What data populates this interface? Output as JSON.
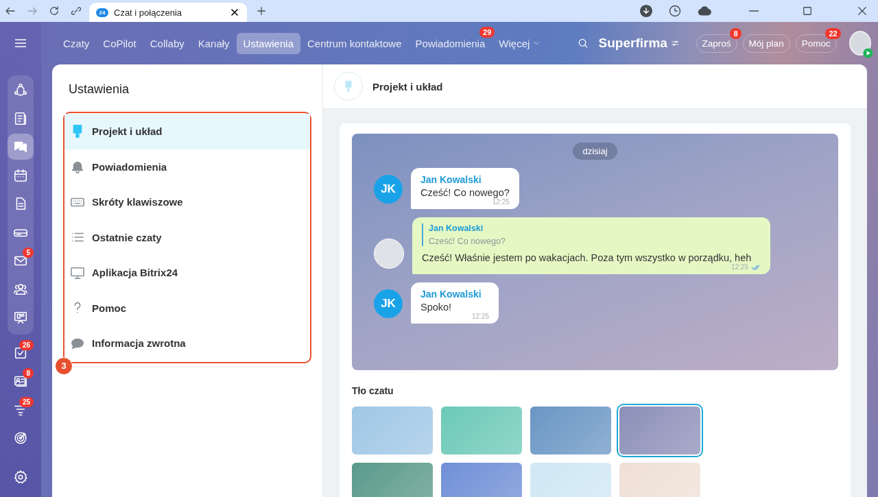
{
  "browser": {
    "tab_icon_text": "24",
    "tab_title": "Czat i połączenia"
  },
  "nav": {
    "tabs": [
      {
        "label": "Czaty",
        "selected": false
      },
      {
        "label": "CoPilot",
        "selected": false
      },
      {
        "label": "Collaby",
        "selected": false
      },
      {
        "label": "Kanały",
        "selected": false
      },
      {
        "label": "Ustawienia",
        "selected": true
      },
      {
        "label": "Centrum kontaktowe",
        "selected": false
      },
      {
        "label": "Powiadomienia",
        "selected": false,
        "badge": "29"
      },
      {
        "label": "Więcej",
        "selected": false
      }
    ],
    "company": "Superfirma",
    "buttons": [
      {
        "label": "Zaproś",
        "badge": "8"
      },
      {
        "label": "Mój plan"
      },
      {
        "label": "Pomoc",
        "badge": "22"
      }
    ]
  },
  "rail": {
    "pinned_items": [
      {
        "selected": false
      },
      {
        "selected": false
      },
      {
        "selected": true
      },
      {
        "selected": false
      },
      {
        "selected": false
      },
      {
        "selected": false
      },
      {
        "selected": false,
        "badge": "5"
      },
      {
        "selected": false
      },
      {
        "selected": false
      }
    ],
    "items": [
      {
        "selected": false,
        "badge": "26"
      },
      {
        "selected": false,
        "badge": "8"
      },
      {
        "selected": false,
        "badge": "25"
      },
      {
        "selected": false
      }
    ]
  },
  "settings": {
    "title": "Ustawienia",
    "annotation": "3",
    "items": [
      {
        "label": "Projekt i układ",
        "selected": true
      },
      {
        "label": "Powiadomienia",
        "selected": false
      },
      {
        "label": "Skróty klawiszowe",
        "selected": false
      },
      {
        "label": "Ostatnie czaty",
        "selected": false
      },
      {
        "label": "Aplikacja Bitrix24",
        "selected": false
      },
      {
        "label": "Pomoc",
        "selected": false
      },
      {
        "label": "Informacja zwrotna",
        "selected": false
      }
    ]
  },
  "header": {
    "title": "Projekt i układ"
  },
  "preview": {
    "date": "dzisiaj",
    "messages": [
      {
        "kind": "incoming",
        "avatar": "JK",
        "author": "Jan Kowalski",
        "text": "Cześć! Co nowego?",
        "time": "12:25"
      },
      {
        "kind": "outgoing",
        "quote_author": "Jan Kowalski",
        "quote_text": "Cześć! Co nowego?",
        "text": "Cześć! Właśnie jestem po wakacjach. Poza tym wszystko w porządku, heh",
        "time": "12:25",
        "read": true
      },
      {
        "kind": "incoming",
        "avatar": "JK",
        "author": "Jan Kowalski",
        "text": "Spoko!",
        "time": "12:25"
      }
    ]
  },
  "backgrounds": {
    "title": "Tło czatu",
    "swatches": [
      {
        "color": "#9fc7e6",
        "selected": false
      },
      {
        "color": "#6cc9b8",
        "selected": false
      },
      {
        "color": "#6a96c4",
        "selected": false
      },
      {
        "color": "#8c8fb8",
        "selected": true
      },
      {
        "color": "#5a9a8a",
        "selected": false
      },
      {
        "color": "#6f8fd6",
        "selected": false
      },
      {
        "color": "#cfe8f4",
        "selected": false
      },
      {
        "color": "#efe0d6",
        "selected": false
      }
    ]
  }
}
